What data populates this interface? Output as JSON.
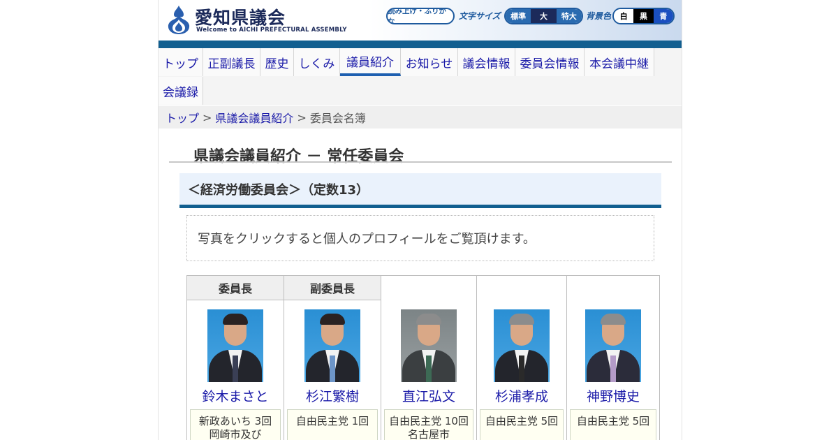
{
  "header": {
    "title": "愛知県議会",
    "subtitle": "Welcome to AICHI PREFECTURAL ASSEMBLY",
    "read_aloud": "読み上げ・ふりがな",
    "font_size_label": "文字サイズ",
    "font_sizes": [
      "標準",
      "大",
      "特大"
    ],
    "bg_color_label": "背景色",
    "bg_colors": [
      "白",
      "黒",
      "青"
    ]
  },
  "nav": {
    "items": [
      "トップ",
      "正副議長",
      "歴史",
      "しくみ",
      "議員紹介",
      "お知らせ",
      "議会情報",
      "委員会情報",
      "本会議中継",
      "会議録"
    ],
    "active": "議員紹介"
  },
  "breadcrumb": {
    "top": "トップ",
    "sep": ">",
    "members": "県議会議員紹介",
    "current": "委員会名簿"
  },
  "heading": "県議会議員紹介 － 常任委員会",
  "committee": "＜経済労働委員会＞（定数13）",
  "notice": "写真をクリックすると個人のプロフィールをご覧頂けます。",
  "members": [
    {
      "role": "委員長",
      "name": "鈴木まさと",
      "party": "新政あいち 3回",
      "district": "岡崎市及び"
    },
    {
      "role": "副委員長",
      "name": "杉江繁樹",
      "party": "自由民主党 1回",
      "district": ""
    },
    {
      "role": "",
      "name": "直江弘文",
      "party": "自由民主党 10回",
      "district": "名古屋市"
    },
    {
      "role": "",
      "name": "杉浦孝成",
      "party": "自由民主党 5回",
      "district": ""
    },
    {
      "role": "",
      "name": "神野博史",
      "party": "自由民主党 5回",
      "district": ""
    }
  ],
  "colors": {
    "header_bar": "#125f90",
    "link": "#1a1aa8",
    "committee_bg": "#eaf2fc"
  }
}
